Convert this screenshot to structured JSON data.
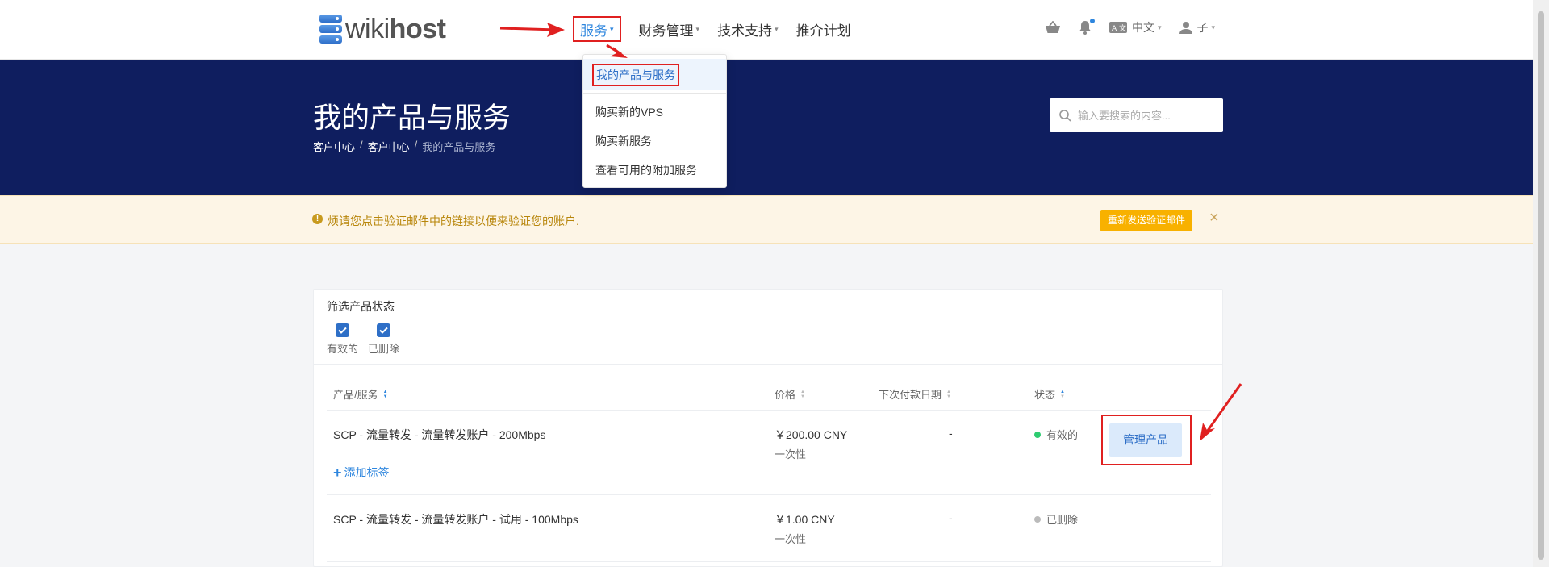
{
  "logo": {
    "text_light": "wiki",
    "text_bold": "host"
  },
  "nav": {
    "items": [
      {
        "label": "服务",
        "caret": "▾"
      },
      {
        "label": "财务管理",
        "caret": "▾"
      },
      {
        "label": "技术支持",
        "caret": "▾"
      },
      {
        "label": "推介计划",
        "caret": ""
      }
    ]
  },
  "header_tools": {
    "language": "中文",
    "user": "子",
    "caret": "▾"
  },
  "dropdown": {
    "items": [
      "我的产品与服务",
      "购买新的VPS",
      "购买新服务",
      "查看可用的附加服务"
    ]
  },
  "hero": {
    "title": "我的产品与服务",
    "breadcrumb": [
      "客户中心",
      "客户中心",
      "我的产品与服务"
    ],
    "breadcrumb_sep": "/",
    "search_placeholder": "输入要搜索的内容..."
  },
  "alert": {
    "icon": "!",
    "text": "烦请您点击验证邮件中的链接以便来验证您的账户.",
    "button": "重新发送验证邮件",
    "close": "×"
  },
  "filter": {
    "title": "筛选产品状态",
    "options": [
      {
        "label": "有效的",
        "checked": true
      },
      {
        "label": "已删除",
        "checked": true
      }
    ]
  },
  "table": {
    "headers": [
      "产品/服务",
      "价格",
      "下次付款日期",
      "状态"
    ],
    "rows": [
      {
        "product": "SCP - 流量转发 - 流量转发账户 - 200Mbps",
        "price": "￥200.00 CNY",
        "cycle": "一次性",
        "next_due": "-",
        "status": "有效的",
        "status_color": "#2ecc71",
        "add_tag": "添加标签",
        "action": "管理产品"
      },
      {
        "product": "SCP - 流量转发 - 流量转发账户 - 试用 - 100Mbps",
        "price": "￥1.00 CNY",
        "cycle": "一次性",
        "next_due": "-",
        "status": "已删除",
        "status_color": "#bbbbbb"
      }
    ]
  },
  "colors": {
    "accent": "#2e86de",
    "hero_bg": "#0f1e5f",
    "annotation": "#e02020",
    "warning": "#f8b100"
  }
}
